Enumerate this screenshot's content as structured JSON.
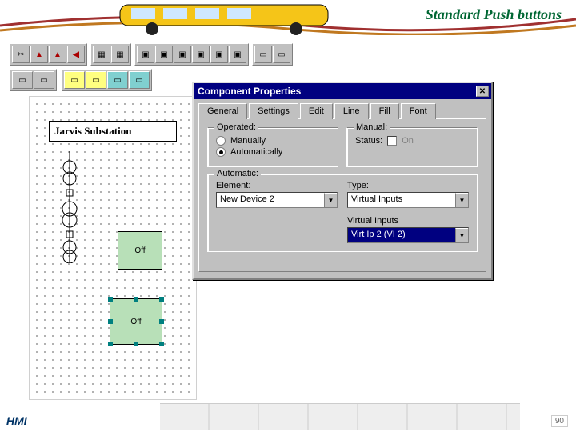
{
  "slide": {
    "title": "Standard Push buttons",
    "footer_label": "HMI",
    "slide_number": "90"
  },
  "canvas": {
    "title_box": "Jarvis Substation",
    "pb1": "Off",
    "pb2": "Off"
  },
  "dialog": {
    "title": "Component Properties",
    "tabs": {
      "general": "General",
      "settings": "Settings",
      "edit": "Edit",
      "line": "Line",
      "fill": "Fill",
      "font": "Font"
    },
    "operated": {
      "legend": "Operated:",
      "opt_manual": "Manually",
      "opt_auto": "Automatically"
    },
    "manual": {
      "legend": "Manual:",
      "status_label": "Status:",
      "status_value": "On"
    },
    "automatic": {
      "legend": "Automatic:",
      "element_label": "Element:",
      "element_value": "New Device 2",
      "type_label": "Type:",
      "type_value": "Virtual Inputs",
      "vi_label": "Virtual Inputs",
      "vi_value": "Virt Ip 2 (VI  2)"
    }
  }
}
